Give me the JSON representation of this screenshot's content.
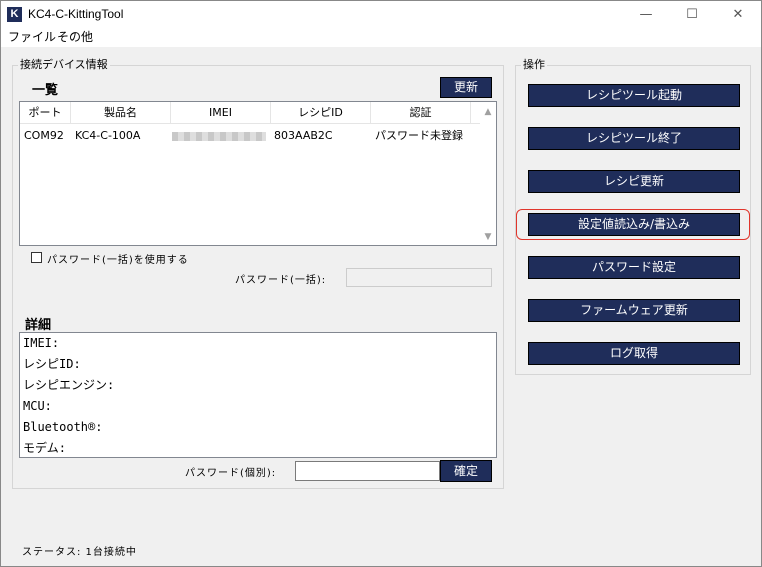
{
  "window": {
    "title": "KC4-C-KittingTool",
    "icon_letter": "K",
    "controls": {
      "minimize": "—",
      "maximize": "☐",
      "close": "✕"
    }
  },
  "menu": [
    "ファイル",
    "その他"
  ],
  "device_group": {
    "label": "接続デバイス情報",
    "list_title": "一覧",
    "refresh_label": "更新",
    "columns": [
      "ポート",
      "製品名",
      "IMEI",
      "レシピID",
      "認証"
    ],
    "rows": [
      {
        "port": "COM92",
        "product": "KC4-C-100A",
        "imei": "",
        "recipe_id": "803AAB2C",
        "auth": "パスワード未登録"
      }
    ],
    "use_password_bulk_label": "パスワード(一括)を使用する",
    "use_password_bulk_checked": false,
    "password_bulk_label": "パスワード(一括):",
    "password_bulk_value": "",
    "detail_title": "詳細",
    "details": [
      "IMEI:",
      "レシピID:",
      "レシピエンジン:",
      "MCU:",
      "Bluetooth®:",
      "モデム:"
    ],
    "password_individual_label": "パスワード(個別):",
    "password_individual_value": "",
    "confirm_label": "確定"
  },
  "operations": {
    "label": "操作",
    "buttons": [
      "レシピツール起動",
      "レシピツール終了",
      "レシピ更新",
      "設定値読込み/書込み",
      "パスワード設定",
      "ファームウェア更新",
      "ログ取得"
    ],
    "highlighted": "設定値読込み/書込み"
  },
  "status_text": "ステータス: 1台接続中",
  "colors": {
    "button_bg": "#1f2d5a",
    "highlight": "#e0352b"
  }
}
